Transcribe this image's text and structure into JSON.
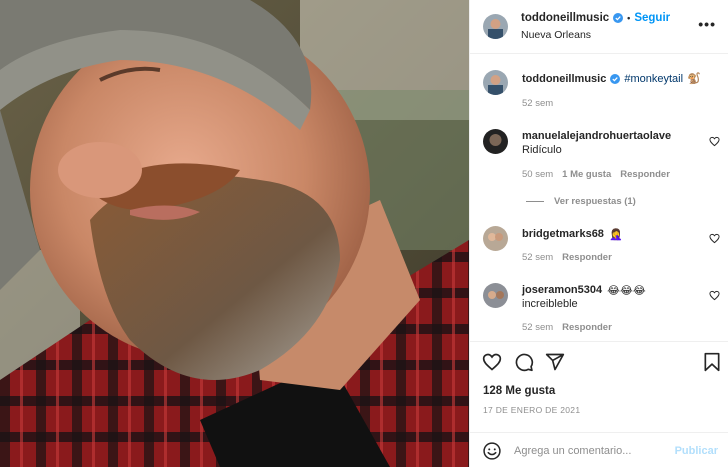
{
  "post": {
    "author": "toddoneillmusic",
    "follow_label": "Seguir",
    "location": "Nueva Orleans",
    "more_label": "•••"
  },
  "caption": {
    "author": "toddoneillmusic",
    "hashtag": "#monkeytail",
    "emoji": "🐒",
    "time": "52 sem"
  },
  "comments": [
    {
      "user": "manuelalejandrohuertaolave",
      "text": "Ridículo",
      "time": "50 sem",
      "likes": "1 Me gusta",
      "reply": "Responder",
      "replies": "Ver respuestas (1)"
    },
    {
      "user": "bridgetmarks68",
      "text": "🤦‍♀️",
      "time": "52 sem",
      "reply": "Responder"
    },
    {
      "user": "joseramon5304",
      "text": "😂😂😂",
      "subtext": "increibleble",
      "time": "52 sem",
      "reply": "Responder"
    }
  ],
  "stats": {
    "likes": "128 Me gusta",
    "date": "17 DE ENERO DE 2021"
  },
  "add_comment": {
    "placeholder": "Agrega un comentario...",
    "publish": "Publicar"
  },
  "icons": [
    "verified-icon",
    "more-icon",
    "heart-icon",
    "comment-icon",
    "share-icon",
    "bookmark-icon",
    "emoji-icon"
  ],
  "colors": {
    "accent": "#0095f6",
    "link": "#00376b",
    "muted": "#8e8e8e",
    "publish_disabled": "#b2dffc"
  }
}
